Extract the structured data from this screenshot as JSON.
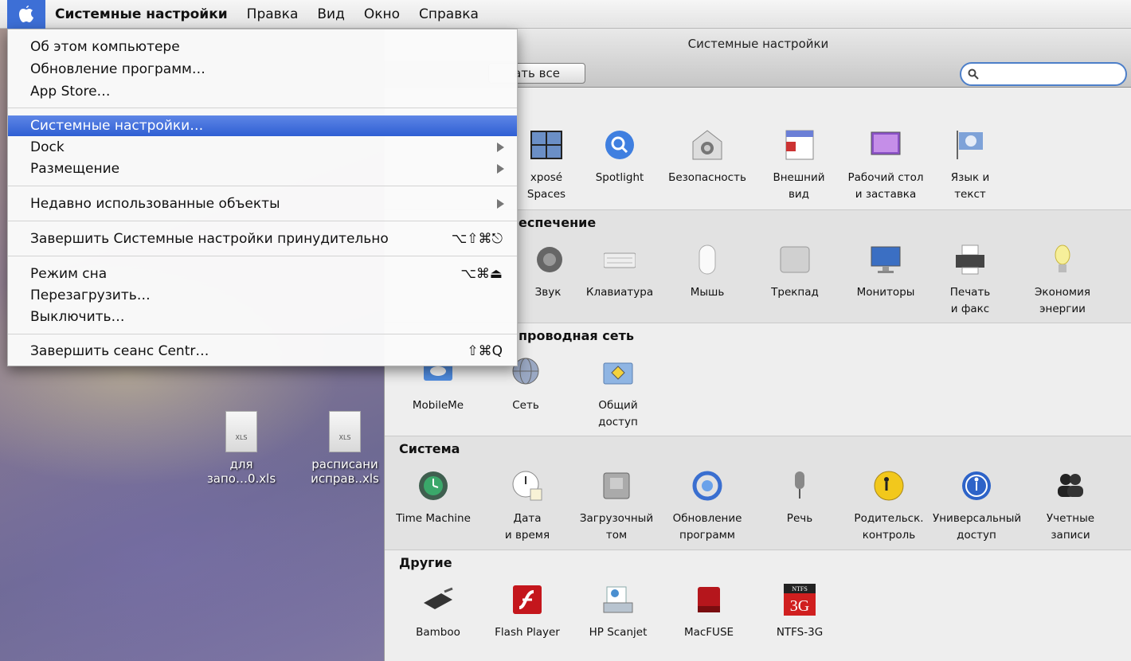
{
  "menubar": {
    "app_name": "Системные настройки",
    "items": [
      "Правка",
      "Вид",
      "Окно",
      "Справка"
    ]
  },
  "apple_menu": {
    "about": "Об этом компьютере",
    "software_update": "Обновление программ…",
    "app_store": "App Store…",
    "system_prefs": "Системные настройки…",
    "dock": "Dock",
    "location": "Размещение",
    "recent": "Недавно использованные объекты",
    "force_quit": "Завершить Системные настройки принудительно",
    "force_quit_shortcut": "⌥⇧⌘⎋",
    "sleep": "Режим сна",
    "sleep_shortcut": "⌥⌘⏏",
    "restart": "Перезагрузить…",
    "shutdown": "Выключить…",
    "logout": "Завершить сеанс Centr…",
    "logout_shortcut": "⇧⌘Q"
  },
  "window": {
    "title": "Системные настройки",
    "show_all": "ать все",
    "search_placeholder": ""
  },
  "sections": {
    "personal": {
      "title": "",
      "panes": [
        {
          "label1": "xposé",
          "label2": "Spaces",
          "icon": "expose-icon"
        },
        {
          "label1": "Spotlight",
          "label2": "",
          "icon": "spotlight-icon"
        },
        {
          "label1": "Безопасность",
          "label2": "",
          "icon": "security-icon"
        },
        {
          "label1": "Внешний",
          "label2": "вид",
          "icon": "appearance-icon"
        },
        {
          "label1": "Рабочий стол",
          "label2": "и заставка",
          "icon": "desktop-icon"
        },
        {
          "label1": "Язык и",
          "label2": "текст",
          "icon": "language-icon"
        }
      ]
    },
    "hardware": {
      "title": "еспечение",
      "panes": [
        {
          "label1": "Звук",
          "label2": "",
          "icon": "sound-icon"
        },
        {
          "label1": "Клавиатура",
          "label2": "",
          "icon": "keyboard-icon"
        },
        {
          "label1": "Мышь",
          "label2": "",
          "icon": "mouse-icon"
        },
        {
          "label1": "Трекпад",
          "label2": "",
          "icon": "trackpad-icon"
        },
        {
          "label1": "Мониторы",
          "label2": "",
          "icon": "monitor-icon"
        },
        {
          "label1": "Печать",
          "label2": "и факс",
          "icon": "printer-icon"
        },
        {
          "label1": "Экономия",
          "label2": "энергии",
          "icon": "energy-icon"
        }
      ]
    },
    "internet": {
      "title": "проводная сеть",
      "panes": [
        {
          "label1": "MobileMe",
          "label2": "",
          "icon": "mobileme-icon"
        },
        {
          "label1": "Сеть",
          "label2": "",
          "icon": "network-icon"
        },
        {
          "label1": "Общий",
          "label2": "доступ",
          "icon": "sharing-icon"
        }
      ]
    },
    "system": {
      "title": "Система",
      "panes": [
        {
          "label1": "Time Machine",
          "label2": "",
          "icon": "time-machine-icon"
        },
        {
          "label1": "Дата",
          "label2": "и время",
          "icon": "date-time-icon"
        },
        {
          "label1": "Загрузочный",
          "label2": "том",
          "icon": "startup-disk-icon"
        },
        {
          "label1": "Обновление",
          "label2": "программ",
          "icon": "software-update-icon"
        },
        {
          "label1": "Речь",
          "label2": "",
          "icon": "speech-icon"
        },
        {
          "label1": "Родительск.",
          "label2": "контроль",
          "icon": "parental-controls-icon"
        },
        {
          "label1": "Универсальный",
          "label2": "доступ",
          "icon": "universal-access-icon"
        },
        {
          "label1": "Учетные",
          "label2": "записи",
          "icon": "accounts-icon"
        }
      ]
    },
    "other": {
      "title": "Другие",
      "panes": [
        {
          "label1": "Bamboo",
          "label2": "",
          "icon": "bamboo-icon"
        },
        {
          "label1": "Flash Player",
          "label2": "",
          "icon": "flash-icon"
        },
        {
          "label1": "HP Scanjet",
          "label2": "",
          "icon": "scanner-icon"
        },
        {
          "label1": "MacFUSE",
          "label2": "",
          "icon": "macfuse-icon"
        },
        {
          "label1": "NTFS-3G",
          "label2": "",
          "icon": "ntfs-icon"
        }
      ]
    }
  },
  "desktop_files": [
    {
      "line1": "для",
      "line2": "запо…0.xls",
      "badge": "XLS"
    },
    {
      "line1": "расписани",
      "line2": "исправ..xls",
      "badge": "XLS"
    }
  ],
  "icons": {
    "ntfs_small": "NTFS",
    "ntfs_big": "3G"
  }
}
